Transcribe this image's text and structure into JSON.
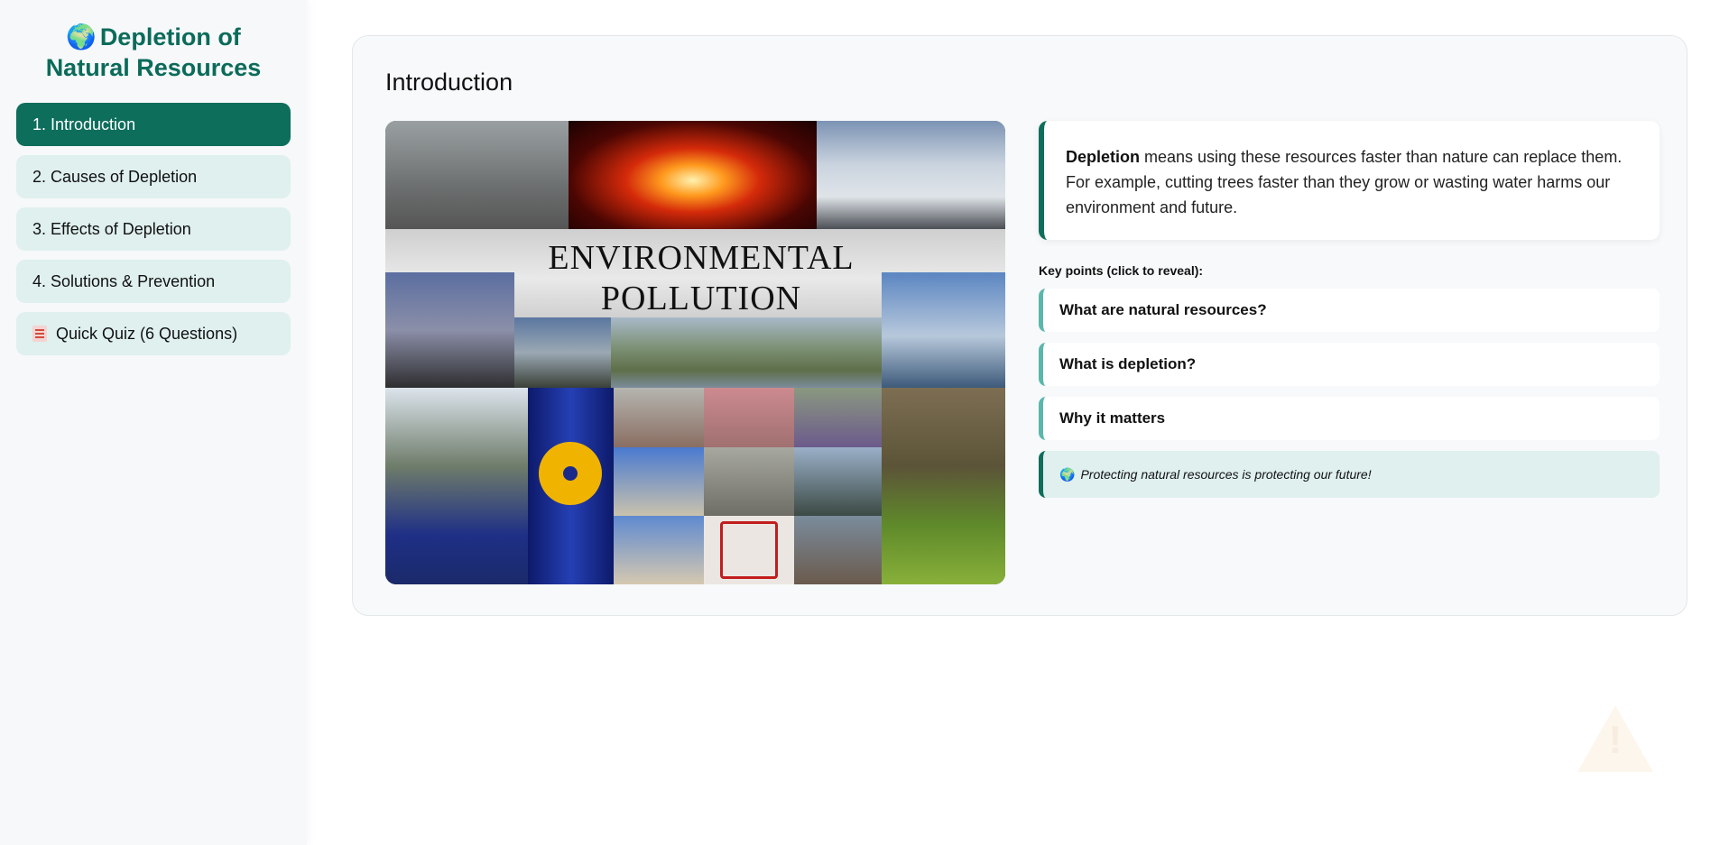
{
  "sidebar": {
    "brand_icon": "globe-icon",
    "brand_line1": "Depletion of",
    "brand_line2": "Natural Resources",
    "items": [
      {
        "label": "1. Introduction",
        "active": true
      },
      {
        "label": "2. Causes of Depletion",
        "active": false
      },
      {
        "label": "3. Effects of Depletion",
        "active": false
      },
      {
        "label": "4. Solutions & Prevention",
        "active": false
      },
      {
        "label": "Quick Quiz (6 Questions)",
        "active": false,
        "icon": "memo-icon"
      }
    ]
  },
  "main": {
    "title": "Introduction",
    "image": {
      "banner_line1": "ENVIRONMENTAL",
      "banner_line2": "POLLUTION"
    },
    "definition": {
      "term": "Depletion",
      "text": " means using these resources faster than nature can replace them. For example, cutting trees faster than they grow or wasting water harms our environment and future."
    },
    "key_points_heading": "Key points (click to reveal):",
    "key_points": [
      "What are natural resources?",
      "What is depletion?",
      "Why it matters"
    ],
    "note": "Protecting natural resources is protecting our future!",
    "note_icon": "globe-icon"
  },
  "colors": {
    "accent": "#0d6e5c",
    "accent_light": "#dff0ee",
    "key_point_border": "#5ab7ab"
  }
}
